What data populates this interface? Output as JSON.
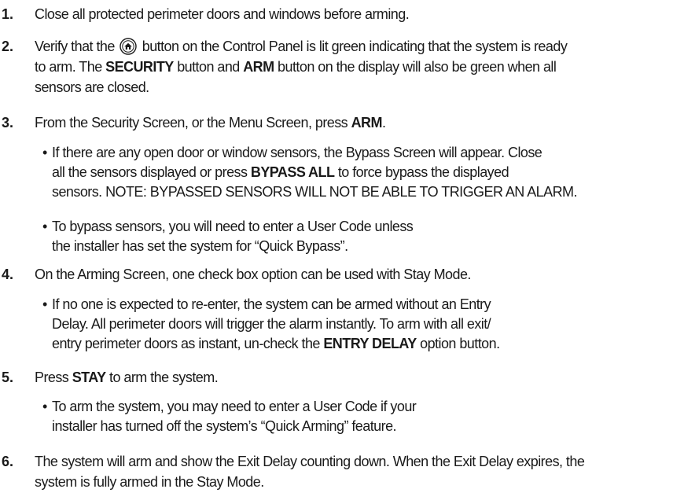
{
  "steps": [
    {
      "number": "1.",
      "lines": [
        [
          "Close all protected perimeter doors and windows before arming."
        ]
      ]
    },
    {
      "number": "2.",
      "line1_a": "Verify that the",
      "icon": "home-button-icon",
      "line1_b": "button on the Control Panel is lit green indicating that the system is ready",
      "line2_a": "to arm. The",
      "security_label": "SECURITY",
      "line2_b": "button and",
      "arm_label": "ARM",
      "line2_c": "button on the display will also be green when all",
      "line3": "sensors are closed."
    },
    {
      "number": "3.",
      "text_a": "From the Security Screen, or the Menu Screen, press",
      "arm_label": "ARM",
      "text_b": ".",
      "bullets": [
        {
          "line1": "If there are any open door or window sensors, the Bypass Screen will appear. Close",
          "line2_a": "all the sensors displayed or press",
          "bypass_label": "BYPASS ALL",
          "line2_b": "to force bypass the displayed",
          "line3": "sensors. NOTE: BYPASSED SENSORS WILL NOT BE ABLE TO TRIGGER AN ALARM."
        },
        {
          "line1": "To bypass sensors, you will need to enter a User Code unless",
          "line2": "the installer has set the system for “Quick Bypass”."
        }
      ]
    },
    {
      "number": "4.",
      "text": "On the Arming Screen, one check box option can be used with Stay Mode.",
      "bullet": {
        "line1": "If no one is expected to re-enter, the system can be armed without an Entry",
        "line2": "Delay. All perimeter doors will trigger the alarm instantly. To arm with all exit/",
        "line3_a": "entry perimeter doors as instant, un-check the",
        "entry_delay_label": "ENTRY DELAY",
        "line3_b": "option button."
      }
    },
    {
      "number": "5.",
      "text_a": "Press",
      "stay_label": "STAY",
      "text_b": "to arm the system.",
      "bullet": {
        "line1": "To arm the system, you may need to enter a User Code if your",
        "line2": "installer has turned off the system’s “Quick Arming” feature."
      }
    },
    {
      "number": "6.",
      "line1": "The system will arm and show the Exit Delay counting down. When the Exit Delay expires, the",
      "line2": "system is fully armed in the Stay Mode."
    }
  ]
}
